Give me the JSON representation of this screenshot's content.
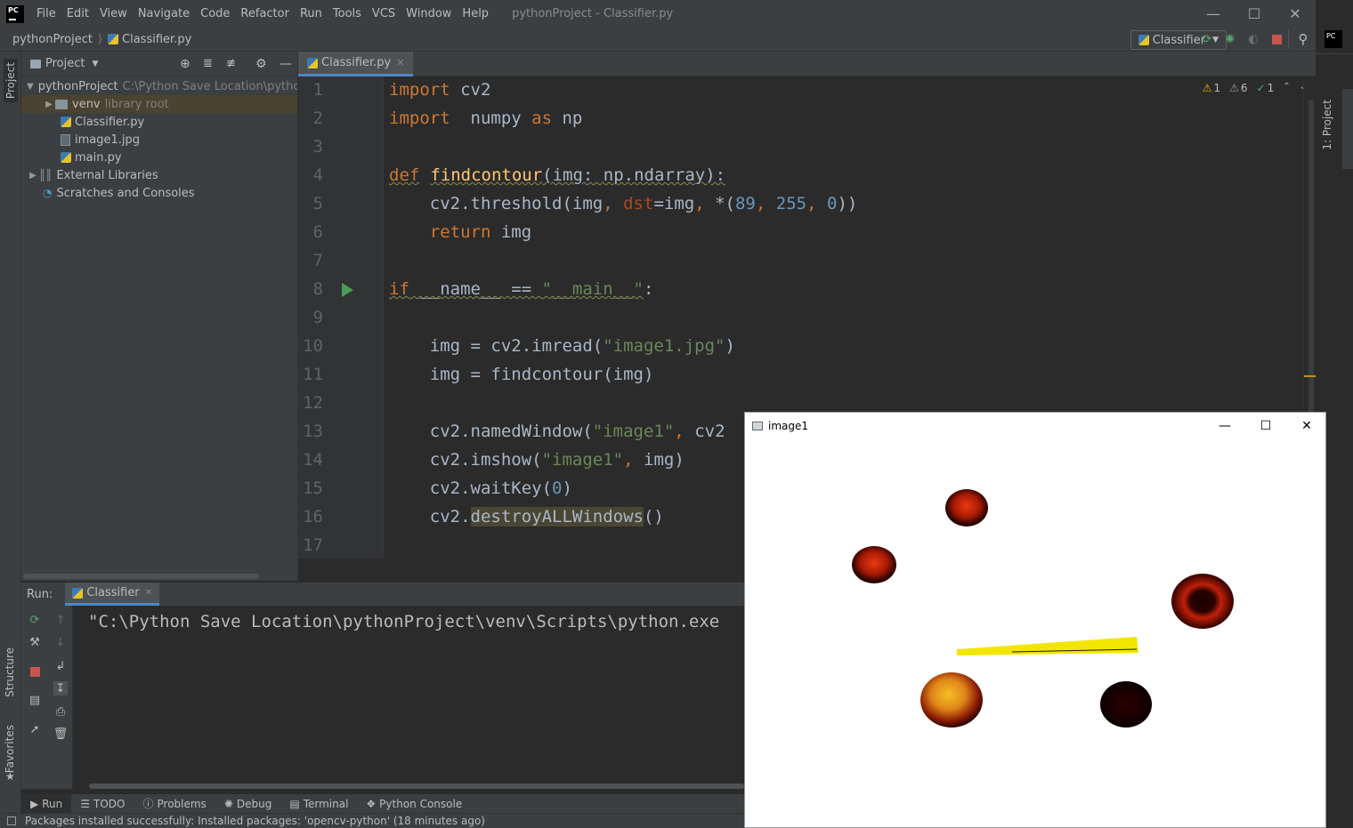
{
  "menubar": {
    "logo": "PC",
    "items": [
      "File",
      "Edit",
      "View",
      "Navigate",
      "Code",
      "Refactor",
      "Run",
      "Tools",
      "VCS",
      "Window",
      "Help"
    ],
    "window_title": "pythonProject - Classifier.py"
  },
  "navbar": {
    "project": "pythonProject",
    "file": "Classifier.py",
    "run_config": "Classifier"
  },
  "left_strip": {
    "project_label": "Project",
    "structure_label": "Structure",
    "favorites_label": "Favorites"
  },
  "project_pane": {
    "title": "Project",
    "tree": {
      "root_name": "pythonProject",
      "root_path": "C:\\Python Save Location\\pytho",
      "venv": "venv",
      "venv_note": "library root",
      "file1": "Classifier.py",
      "file2": "image1.jpg",
      "file3": "main.py",
      "external": "External Libraries",
      "scratches": "Scratches and Consoles"
    }
  },
  "editor": {
    "tab_label": "Classifier.py",
    "inspections": {
      "warn1": "1",
      "warn2": "6",
      "ok": "1"
    },
    "line_numbers": [
      "1",
      "2",
      "3",
      "4",
      "5",
      "6",
      "7",
      "8",
      "9",
      "10",
      "11",
      "12",
      "13",
      "14",
      "15",
      "16",
      "17"
    ],
    "code": {
      "l1_kw": "import",
      "l1_rest": " cv2",
      "l2_kw": "import",
      "l2_rest": "  numpy ",
      "l2_as": "as",
      "l2_np": " np",
      "l4_def": "def",
      "l4_name": "findcontour",
      "l4_rest": "(img: np.ndarray):",
      "l5_a": "    cv2.threshold(img",
      "l5_comma1": ", ",
      "l5_param": "dst",
      "l5_b": "=img",
      "l5_comma2": ", ",
      "l5_c": "*(",
      "l5_n1": "89",
      "l5_comma3": ", ",
      "l5_n2": "255",
      "l5_comma4": ", ",
      "l5_n3": "0",
      "l5_d": "))",
      "l6_kw": "    return",
      "l6_rest": " img",
      "l8_if": "if",
      "l8_mid": " __name__ == ",
      "l8_str": "\"__main__\"",
      "l8_end": ":",
      "l10_a": "    img = cv2.imread(",
      "l10_str": "\"image1.jpg\"",
      "l10_b": ")",
      "l11": "    img = findcontour(img)",
      "l13_a": "    cv2.namedWindow(",
      "l13_str": "\"image1\"",
      "l13_comma": ", ",
      "l13_b": "cv2",
      "l14_a": "    cv2.imshow(",
      "l14_str": "\"image1\"",
      "l14_comma": ", ",
      "l14_b": "img)",
      "l15_a": "    cv2.waitKey(",
      "l15_n": "0",
      "l15_b": ")",
      "l16_a": "    cv2.",
      "l16_hl": "destroyALLWindows",
      "l16_b": "()"
    }
  },
  "run_panel": {
    "label": "Run:",
    "tab": "Classifier",
    "console_line": "\"C:\\Python Save Location\\pythonProject\\venv\\Scripts\\python.exe"
  },
  "bottom_tabs": [
    "Run",
    "TODO",
    "Problems",
    "Debug",
    "Terminal",
    "Python Console"
  ],
  "status_bar": {
    "text": "Packages installed successfully: Installed packages: 'opencv-python' (18 minutes ago)"
  },
  "right_strip": {
    "project_label": "1: Project"
  },
  "image_window": {
    "title": "image1",
    "colors": {
      "yellow": "#f2e600",
      "dark": "#1a0000",
      "red": "#c0200a"
    }
  }
}
